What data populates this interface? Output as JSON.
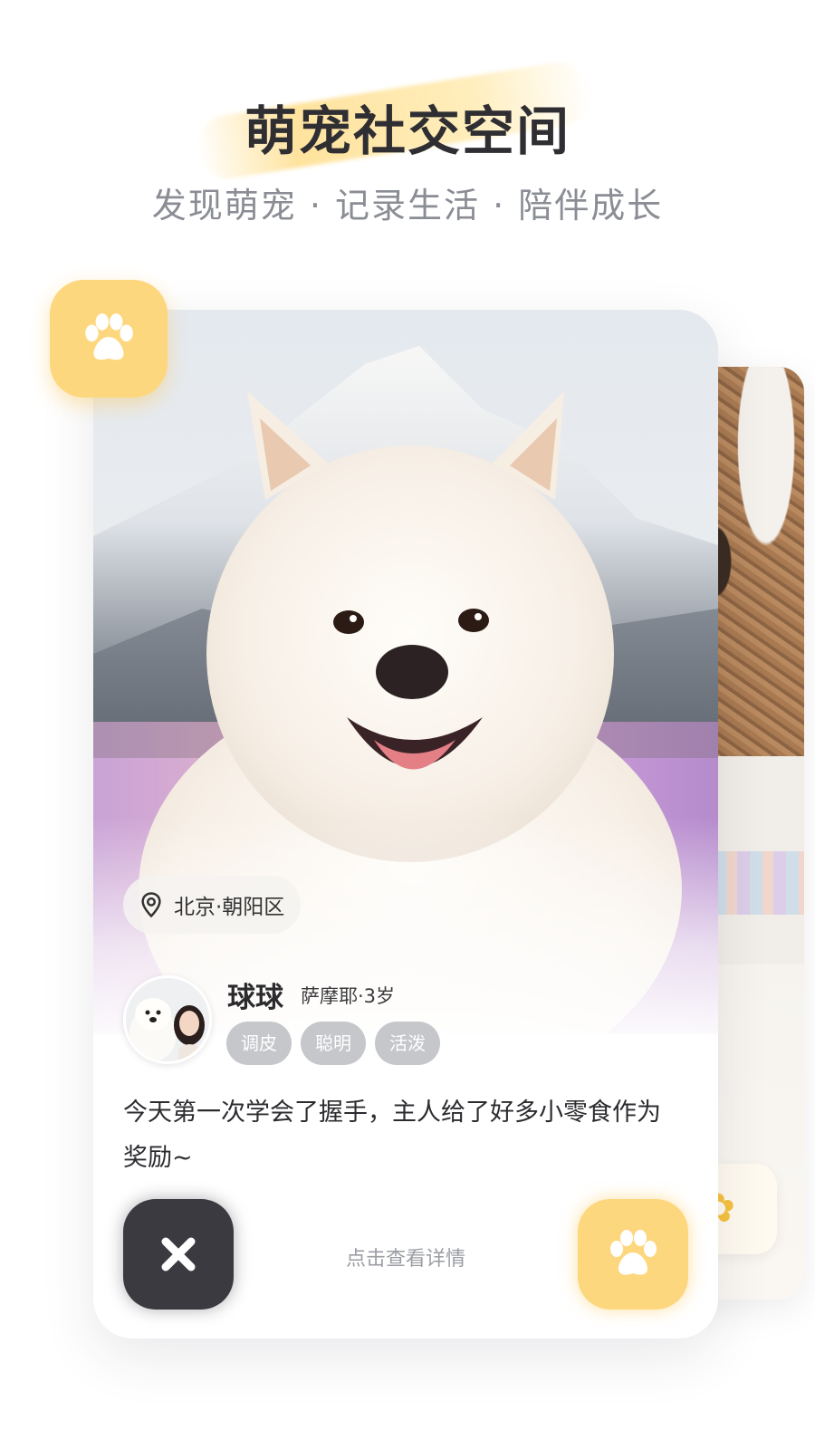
{
  "header": {
    "title": "萌宠社交空间",
    "subtitle": "发现萌宠 · 记录生活 · 陪伴成长"
  },
  "card": {
    "location": "北京·朝阳区",
    "pet": {
      "name": "球球",
      "meta": "萨摩耶·3岁",
      "tags": [
        "调皮",
        "聪明",
        "活泼"
      ]
    },
    "description": "今天第一次学会了握手，主人给了好多小零食作为奖励~",
    "hint": "点击查看详情"
  },
  "icons": {
    "badge": "paw-icon",
    "location": "location-pin-icon",
    "dismiss": "close-icon",
    "like": "paw-icon"
  },
  "colors": {
    "accent": "#fdd77e",
    "dark_button": "#3a3a40",
    "tag_bg": "#c6c7cb",
    "title": "#2f2f33",
    "subtitle": "#8a8d94"
  }
}
